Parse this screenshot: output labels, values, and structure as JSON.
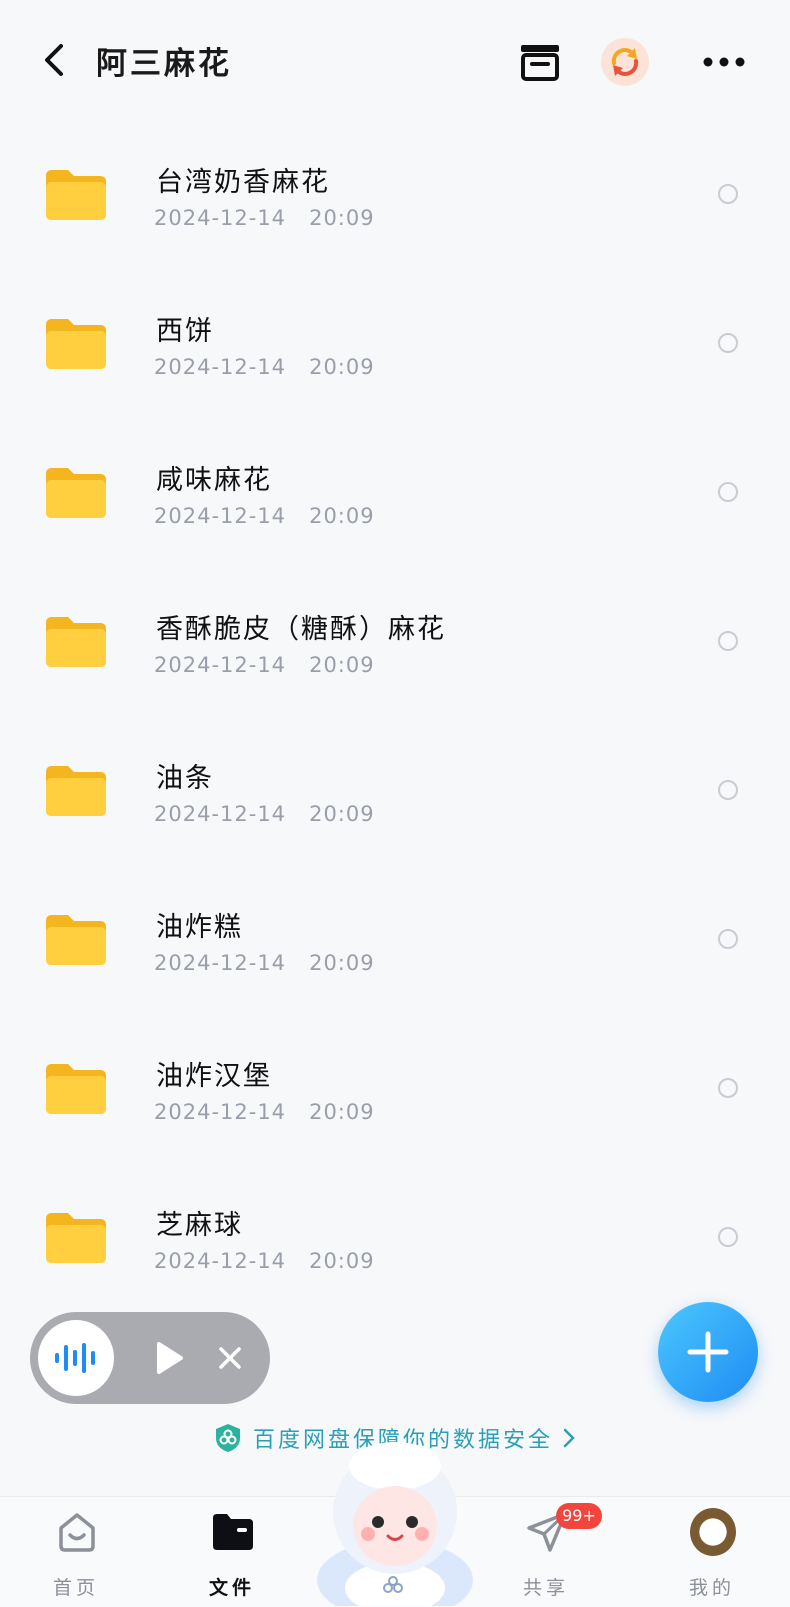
{
  "header": {
    "title": "阿三麻花",
    "icons": [
      "back-icon",
      "archive-icon",
      "sync-icon",
      "more-icon"
    ]
  },
  "files": [
    {
      "name": "台湾奶香麻花",
      "date": "2024-12-14",
      "time": "20:09"
    },
    {
      "name": "西饼",
      "date": "2024-12-14",
      "time": "20:09"
    },
    {
      "name": "咸味麻花",
      "date": "2024-12-14",
      "time": "20:09"
    },
    {
      "name": "香酥脆皮（糖酥）麻花",
      "date": "2024-12-14",
      "time": "20:09"
    },
    {
      "name": "油条",
      "date": "2024-12-14",
      "time": "20:09"
    },
    {
      "name": "油炸糕",
      "date": "2024-12-14",
      "time": "20:09"
    },
    {
      "name": "油炸汉堡",
      "date": "2024-12-14",
      "time": "20:09"
    },
    {
      "name": "芝麻球",
      "date": "2024-12-14",
      "time": "20:09"
    }
  ],
  "security": {
    "text": "百度网盘保障你的数据安全",
    "icons": [
      "shield-icon",
      "chevron-right-icon"
    ]
  },
  "nav": {
    "home": "首页",
    "files": "文件",
    "share": "共享",
    "share_badge": "99+",
    "mine": "我的"
  },
  "colors": {
    "accent": "#1e8cf2",
    "folder": "#ffc83d",
    "badge": "#f2453d",
    "security": "#2a9fb5"
  }
}
